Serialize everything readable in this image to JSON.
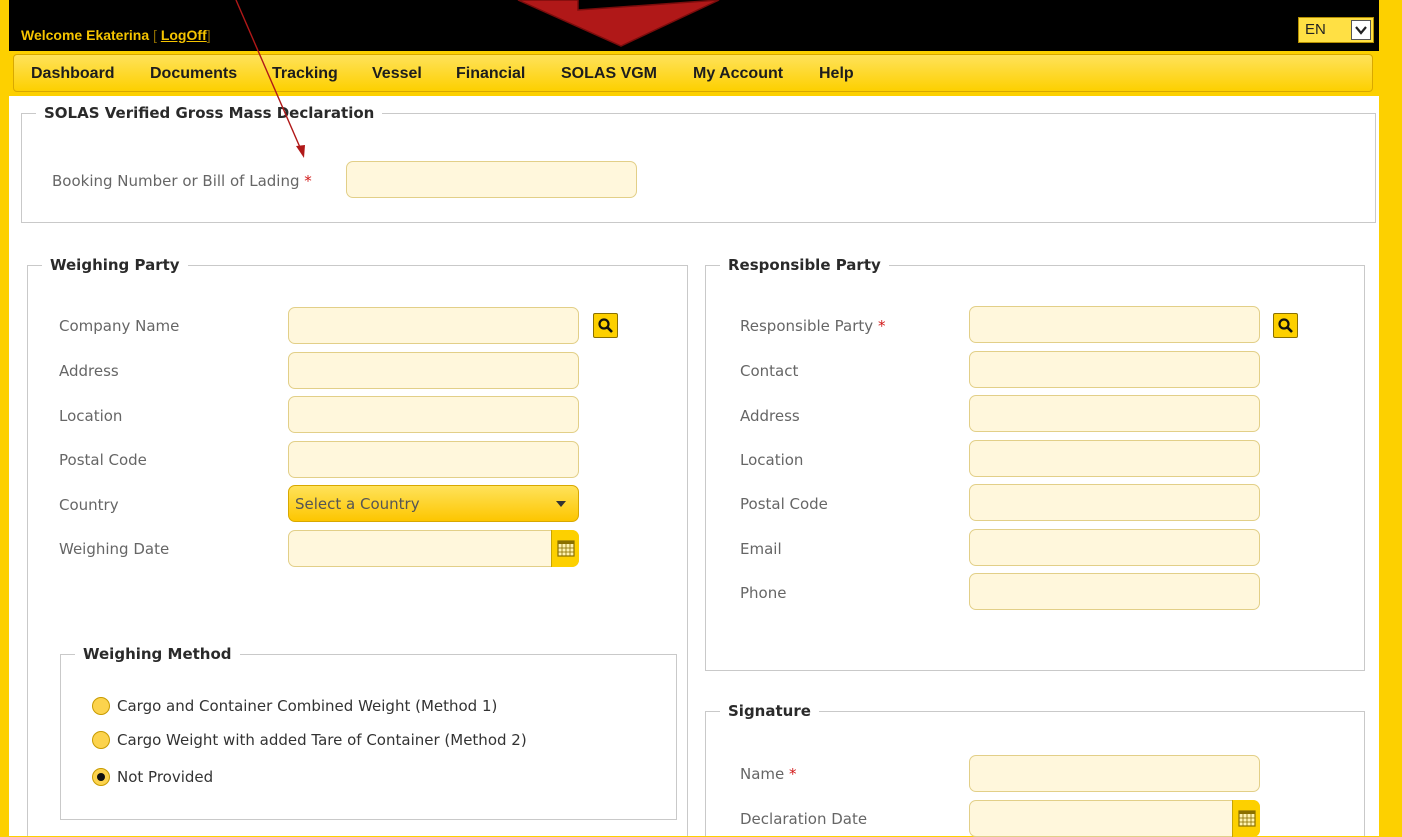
{
  "header": {
    "welcome_prefix": "Welcome ",
    "user_name": "Ekaterina",
    "bracket_open": " [ ",
    "logoff_label": "LogOff",
    "bracket_close": "]",
    "language": "EN"
  },
  "nav": {
    "items": [
      "Dashboard",
      "Documents",
      "Tracking",
      "Vessel",
      "Financial",
      "SOLAS VGM",
      "My Account",
      "Help"
    ]
  },
  "vgm": {
    "legend": "SOLAS Verified Gross Mass Declaration",
    "booking_label": "Booking Number or Bill of Lading",
    "required_mark": "*",
    "booking_value": ""
  },
  "weighing_party": {
    "legend": "Weighing Party",
    "company_label": "Company Name",
    "address_label": "Address",
    "location_label": "Location",
    "postal_label": "Postal Code",
    "country_label": "Country",
    "country_selected": "Select a Country",
    "date_label": "Weighing Date"
  },
  "weighing_method": {
    "legend": "Weighing Method",
    "options": [
      "Cargo and Container Combined Weight (Method 1)",
      "Cargo Weight with added Tare of Container (Method 2)",
      "Not Provided"
    ],
    "selected_index": 2
  },
  "responsible_party": {
    "legend": "Responsible Party",
    "party_label": "Responsible Party",
    "contact_label": "Contact",
    "address_label": "Address",
    "location_label": "Location",
    "postal_label": "Postal Code",
    "email_label": "Email",
    "phone_label": "Phone"
  },
  "signature": {
    "legend": "Signature",
    "name_label": "Name",
    "date_label": "Declaration Date"
  },
  "colors": {
    "brand_yellow": "#fdd000",
    "header_black": "#000000",
    "input_fill": "#fff7dc",
    "annotation_red": "#b01818"
  },
  "icons": [
    "search-icon",
    "calendar-icon",
    "chevron-down-icon"
  ]
}
